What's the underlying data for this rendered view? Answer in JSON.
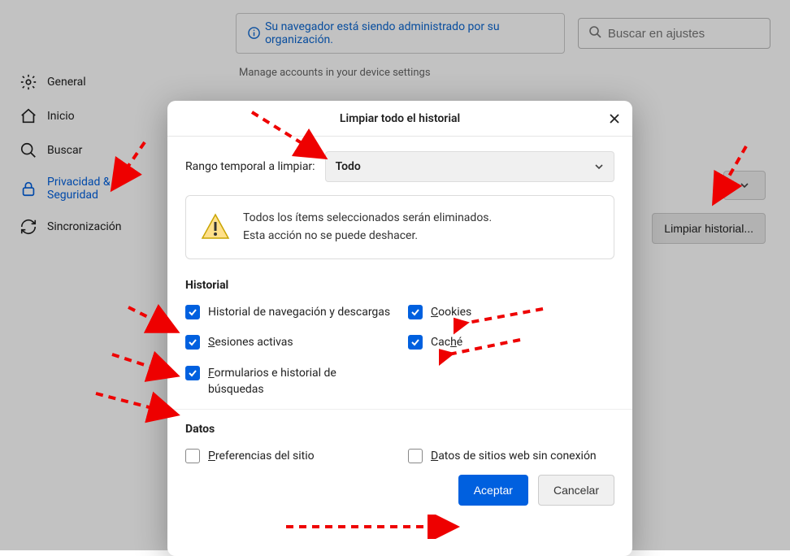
{
  "topbar": {
    "info_text": "Su navegador está siendo administrado por su organización.",
    "search_placeholder": "Buscar en ajustes"
  },
  "sidebar": {
    "items": [
      {
        "label": "General",
        "icon": "gear-icon"
      },
      {
        "label": "Inicio",
        "icon": "home-icon"
      },
      {
        "label": "Buscar",
        "icon": "search-icon"
      },
      {
        "label": "Privacidad & Seguridad",
        "icon": "lock-icon"
      },
      {
        "label": "Sincronización",
        "icon": "sync-icon"
      }
    ]
  },
  "background": {
    "faint_text": "Manage accounts in your device settings",
    "clear_history_button": "Limpiar historial..."
  },
  "dialog": {
    "title": "Limpiar todo el historial",
    "range_label": "Rango temporal a limpiar:",
    "range_value": "Todo",
    "warning_line1": "Todos los ítems seleccionados serán eliminados.",
    "warning_line2": "Esta acción no se puede deshacer.",
    "section_history": "Historial",
    "section_data": "Datos",
    "opts": {
      "browsing": "Historial de navegación y descargas",
      "sessions": "Sesiones activas",
      "forms": "Formularios e historial de búsquedas",
      "cookies": "Cookies",
      "cache": "Caché",
      "site_prefs": "Preferencias del sitio",
      "offline": "Datos de sitios web sin conexión"
    },
    "accept": "Aceptar",
    "cancel": "Cancelar"
  }
}
